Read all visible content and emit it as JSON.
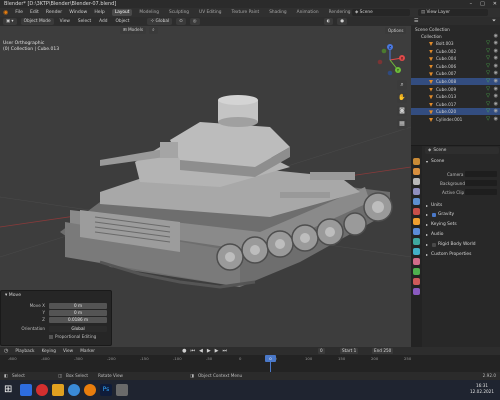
{
  "window": {
    "title": "Blender* [D:\\3KTP\\Blender\\Blender-07.blend]"
  },
  "top_menu": [
    "File",
    "Edit",
    "Render",
    "Window",
    "Help"
  ],
  "workspace_tabs": [
    {
      "label": "Layout",
      "active": true
    },
    {
      "label": "Modeling",
      "active": false
    },
    {
      "label": "Sculpting",
      "active": false
    },
    {
      "label": "UV Editing",
      "active": false
    },
    {
      "label": "Texture Paint",
      "active": false
    },
    {
      "label": "Shading",
      "active": false
    },
    {
      "label": "Animation",
      "active": false
    },
    {
      "label": "Rendering",
      "active": false
    },
    {
      "label": "Compositing",
      "active": false
    }
  ],
  "scene_selector": "Scene",
  "view_layer_selector": "View Layer",
  "viewport": {
    "mode": "Object Mode",
    "menus": [
      "View",
      "Select",
      "Add",
      "Object"
    ],
    "transform_orientation": "Global",
    "pivot": "Models",
    "options_label": "Options",
    "info_line1": "User Orthographic",
    "info_line2": "(0) Collection | Cube.013",
    "gizmo_axes": {
      "x": "X",
      "y": "Y",
      "z": "Z"
    }
  },
  "operator_panel": {
    "title": "Move",
    "fields": [
      {
        "label": "Move X",
        "value": "0 m"
      },
      {
        "label": "Y",
        "value": "0 m"
      },
      {
        "label": "Z",
        "value": "0.0186 m"
      },
      {
        "label": "Orientation",
        "value": "Global"
      }
    ],
    "checkbox_label": "Proportional Editing"
  },
  "outliner": {
    "header": "Scene Collection",
    "collection": "Collection",
    "items": [
      {
        "label": "Bolt.003",
        "selected": false
      },
      {
        "label": "Cube.002",
        "selected": false
      },
      {
        "label": "Cube.004",
        "selected": false
      },
      {
        "label": "Cube.006",
        "selected": false
      },
      {
        "label": "Cube.007",
        "selected": false
      },
      {
        "label": "Cube.008",
        "selected": true
      },
      {
        "label": "Cube.009",
        "selected": false
      },
      {
        "label": "Cube.013",
        "selected": false
      },
      {
        "label": "Cube.017",
        "selected": false
      },
      {
        "label": "Cube.020",
        "selected": true
      },
      {
        "label": "Cylinder.001",
        "selected": false
      }
    ]
  },
  "properties": {
    "context": "Scene",
    "sections": {
      "scene": "Scene",
      "camera_label": "Camera",
      "background_label": "Background",
      "active_clip_label": "Active Clip",
      "units": "Units",
      "gravity": "Gravity",
      "keying_sets": "Keying Sets",
      "audio": "Audio",
      "rigid_body_world": "Rigid Body World",
      "custom_properties": "Custom Properties"
    }
  },
  "timeline": {
    "menus": [
      "Playback",
      "Keying",
      "View",
      "Marker"
    ],
    "current_frame": "0",
    "start_label": "Start",
    "start_value": "1",
    "end_label": "End",
    "end_value": "250",
    "ticks": [
      "-600",
      "-400",
      "-300",
      "-200",
      "-150",
      "-100",
      "-50",
      "0",
      "50",
      "100",
      "150",
      "200",
      "250"
    ]
  },
  "statusbar": {
    "select": "Select",
    "box_select": "Box Select",
    "rotate_view": "Rotate View",
    "context_menu": "Object Context Menu",
    "version": "2.92.0"
  },
  "taskbar": {
    "time": "16:31",
    "date": "12.02.2021"
  },
  "colors": {
    "accent": "#4a78c8",
    "selected_row": "#334d80",
    "viewport_bg": "#3d3d3d"
  }
}
